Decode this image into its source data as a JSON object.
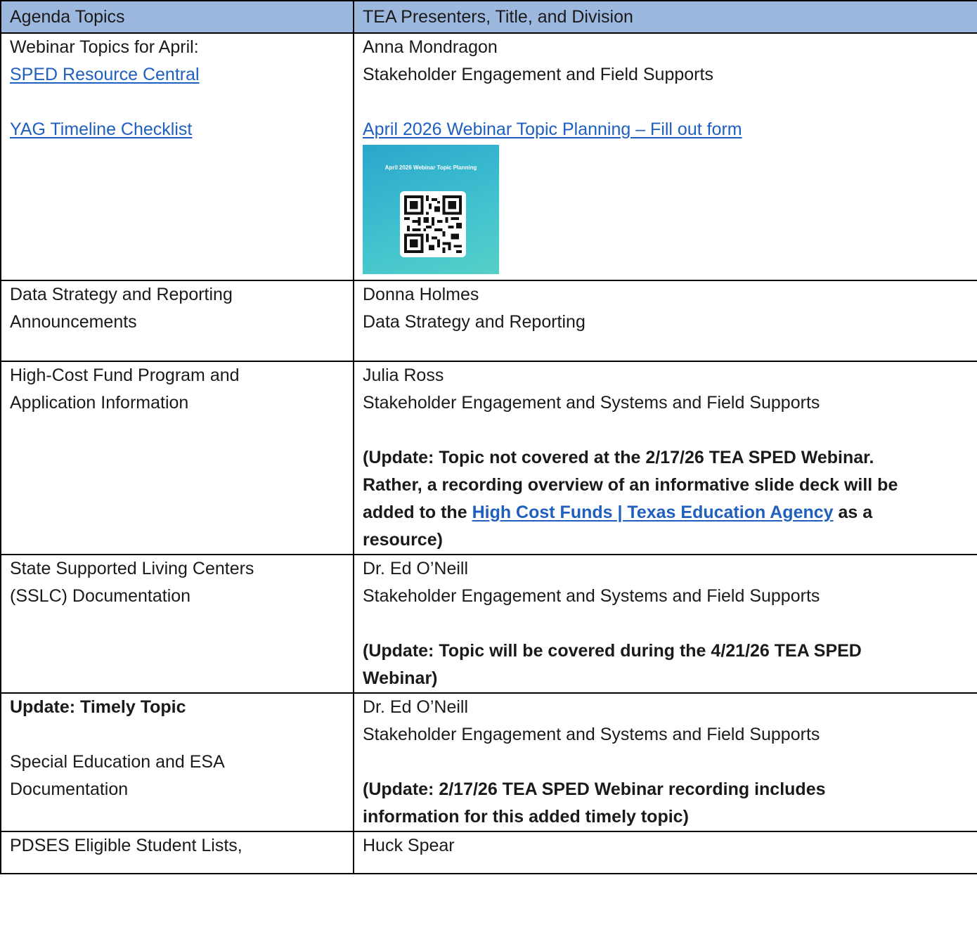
{
  "header": {
    "col1": "Agenda Topics",
    "col2": "TEA Presenters, Title, and Division"
  },
  "rows": [
    {
      "topic_lines": [
        "Webinar Topics for April:"
      ],
      "topic_links": [
        "SPED Resource Central",
        "YAG Timeline Checklist"
      ],
      "presenter": "Anna Mondragon",
      "division": "Stakeholder Engagement and Field Supports",
      "link": "April 2026 Webinar Topic Planning – Fill out form",
      "qr_title": "April 2026 Webinar Topic Planning"
    },
    {
      "topic_lines": [
        "Data Strategy and Reporting",
        "Announcements"
      ],
      "presenter": "Donna Holmes",
      "division": "Data Strategy and Reporting"
    },
    {
      "topic_lines": [
        "High-Cost Fund Program and",
        "Application Information"
      ],
      "presenter": "Julia Ross",
      "division": "Stakeholder Engagement and Systems and Field Supports",
      "update_lines": [
        "(Update: Topic not covered at the 2/17/26 TEA SPED Webinar.",
        "Rather, a recording overview of an informative slide deck will be"
      ],
      "update_prefix": "added to the ",
      "update_link": "High Cost Funds | Texas Education Agency",
      "update_suffix": " as a",
      "update_end": "resource)"
    },
    {
      "topic_lines": [
        "State Supported Living Centers",
        "(SSLC) Documentation"
      ],
      "presenter": "Dr. Ed O’Neill",
      "division": "Stakeholder Engagement and Systems and Field Supports",
      "update_lines": [
        "(Update: Topic will be covered during the 4/21/26 TEA SPED",
        "Webinar)"
      ]
    },
    {
      "topic_bold": "Update: Timely Topic",
      "topic_lines": [
        "Special Education and ESA",
        "Documentation"
      ],
      "presenter": "Dr. Ed O’Neill",
      "division": "Stakeholder Engagement and Systems and Field Supports",
      "update_lines": [
        "(Update: 2/17/26 TEA SPED Webinar recording includes",
        "information for this added timely topic)"
      ]
    },
    {
      "topic_lines": [
        "PDSES Eligible Student Lists,"
      ],
      "presenter": "Huck Spear"
    }
  ],
  "colors": {
    "header_bg": "#9db8df",
    "link": "#1f5fbf",
    "border": "#000000"
  },
  "icons": {
    "qr": "qr-code-icon"
  }
}
